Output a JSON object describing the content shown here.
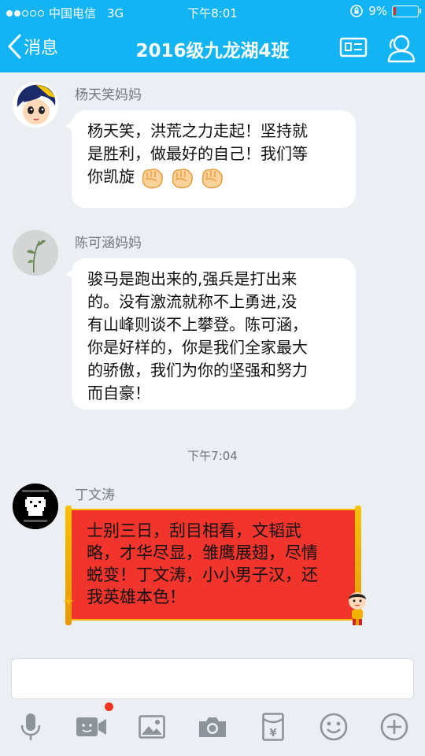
{
  "status_bar": {
    "carrier": "中国电信",
    "network": "3G",
    "time": "下午8:01",
    "battery": "9%",
    "battery_level": 0.09
  },
  "nav": {
    "back_label": "消息",
    "title": "2016级九龙湖4班"
  },
  "messages": [
    {
      "sender": "杨天笑妈妈",
      "lines": [
        "杨天笑，洪荒之力走起！坚持就",
        "是胜利，做最好的自己！我们等",
        "你凯旋"
      ],
      "emoji": "fist-emoji",
      "emoji_count": 3
    },
    {
      "sender": "陈可涵妈妈",
      "lines": [
        "骏马是跑出来的,强兵是打出来",
        "的。没有激流就称不上勇进,没",
        "有山峰则谈不上攀登。陈可涵，",
        "你是好样的，你是我们全家最大",
        "的骄傲，我们为你的坚强和努力",
        "而自豪！"
      ]
    },
    {
      "time_separator": "下午7:04"
    },
    {
      "sender": "丁文涛",
      "lines": [
        "士别三日，刮目相看，文韬武",
        "略，才华尽显，雏鹰展翅，尽情",
        "蜕变！丁文涛，小小男子汉，还",
        "我英雄本色！"
      ],
      "bubble_style": "red-scroll"
    }
  ],
  "toolbar": {
    "icons": [
      "microphone-icon",
      "video-call-icon",
      "image-icon",
      "camera-icon",
      "red-packet-icon",
      "emoji-icon",
      "plus-icon"
    ]
  },
  "colors": {
    "accent": "#13b4f4",
    "notification_dot": "#f0321e",
    "red_bubble": "#f2352c"
  }
}
